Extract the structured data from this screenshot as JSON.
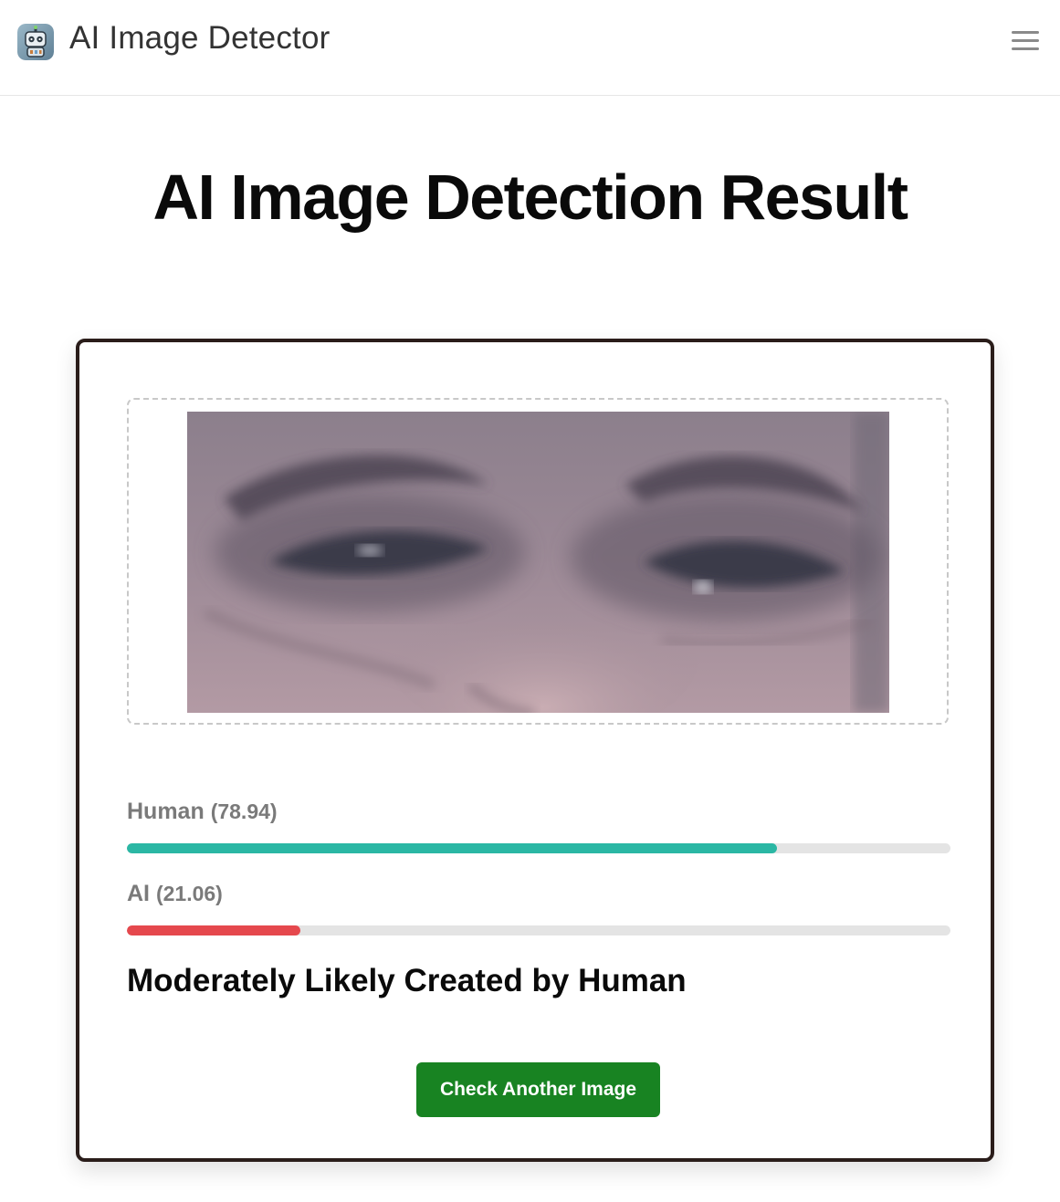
{
  "header": {
    "app_name": "AI Image Detector",
    "logo_icon": "robot-logo-icon",
    "menu_icon": "hamburger-menu-icon"
  },
  "main": {
    "title": "AI Image Detection Result",
    "preview_icon": "uploaded-face-image",
    "metrics": [
      {
        "label": "Human",
        "value_text": "(78.94)",
        "value": 78.94,
        "color": "#2bb7a4"
      },
      {
        "label": "AI",
        "value_text": "(21.06)",
        "value": 21.06,
        "color": "#e5484d"
      }
    ],
    "verdict": "Moderately Likely Created by Human",
    "cta_label": "Check Another Image",
    "cta_color": "#188322"
  }
}
